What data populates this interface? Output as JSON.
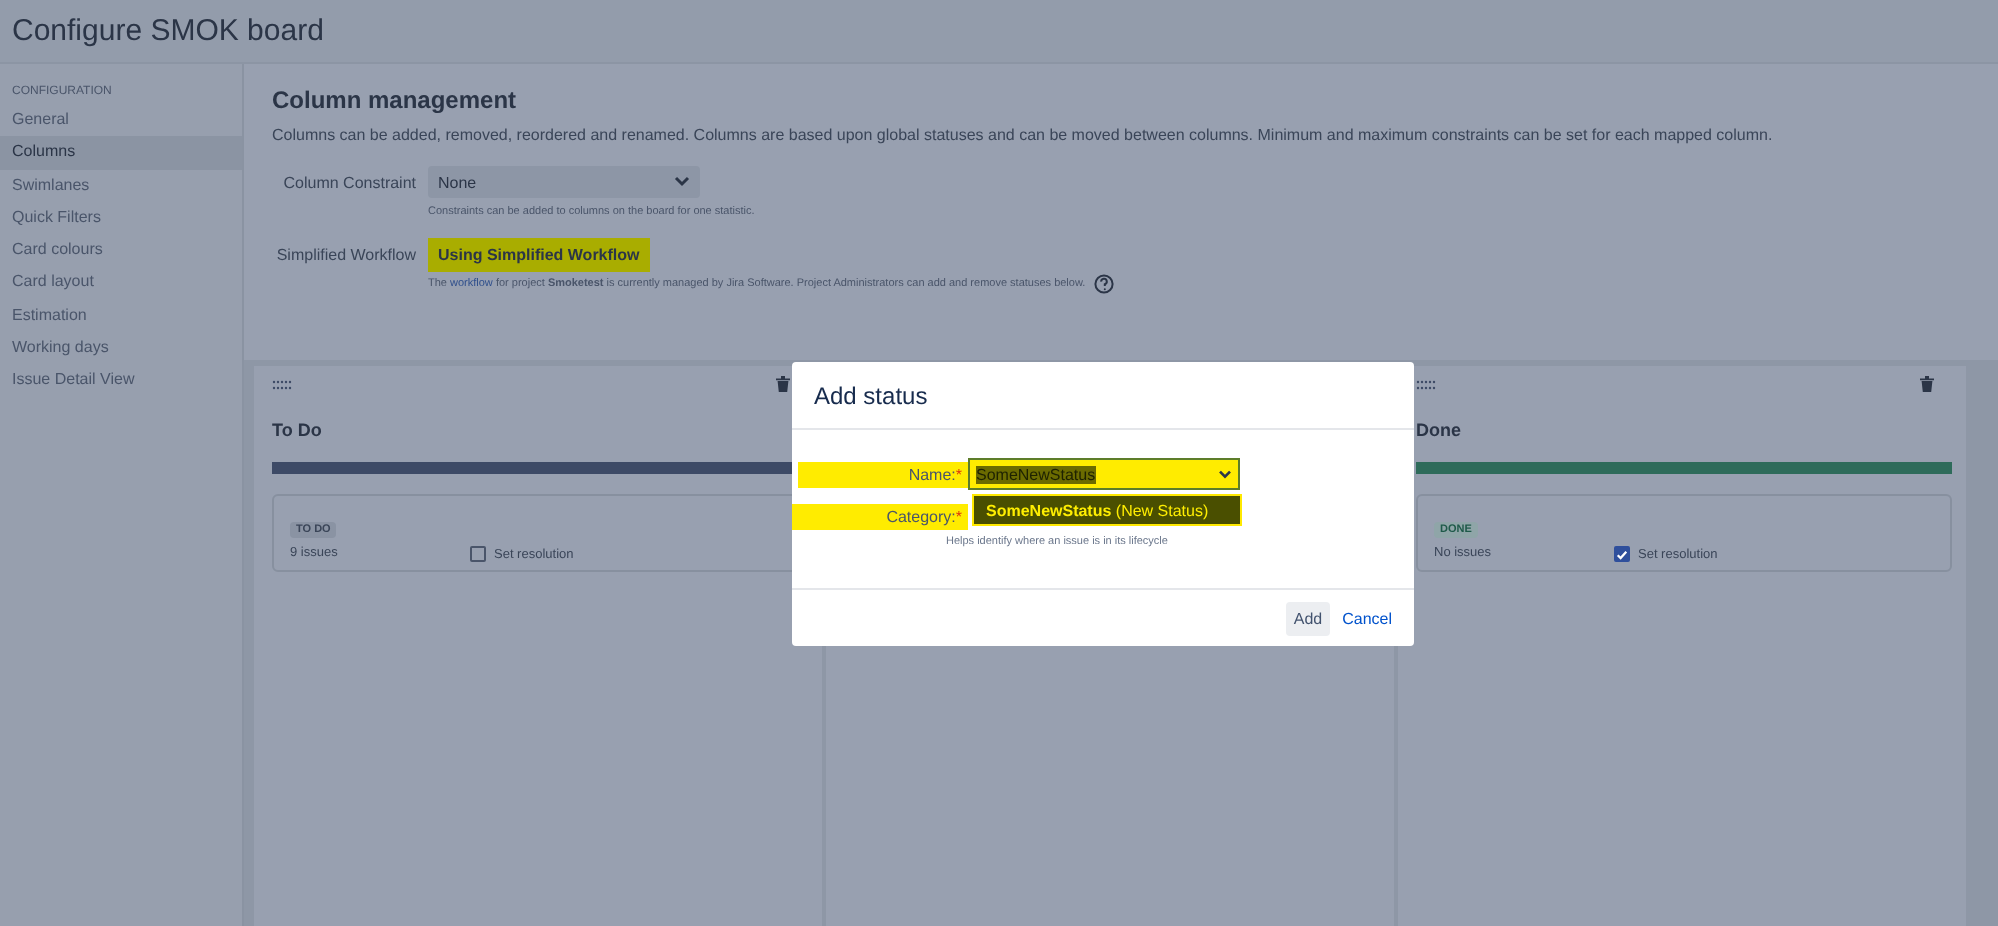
{
  "window": {
    "title": "Configure SMOK board"
  },
  "sidebar": {
    "heading": "CONFIGURATION",
    "items": [
      {
        "label": "General",
        "selected": false
      },
      {
        "label": "Columns",
        "selected": true
      },
      {
        "label": "Swimlanes",
        "selected": false
      },
      {
        "label": "Quick Filters",
        "selected": false
      },
      {
        "label": "Card colours",
        "selected": false
      },
      {
        "label": "Card layout",
        "selected": false
      },
      {
        "label": "Estimation",
        "selected": false
      },
      {
        "label": "Working days",
        "selected": false
      },
      {
        "label": "Issue Detail View",
        "selected": false
      }
    ]
  },
  "section": {
    "title": "Column management",
    "description": "Columns can be added, removed, reordered and renamed. Columns are based upon global statuses and can be moved between columns. Minimum and maximum constraints can be set for each mapped column.",
    "constraint": {
      "label": "Column Constraint",
      "value": "None",
      "hint": "Constraints can be added to columns on the board for one statistic."
    },
    "workflow": {
      "label": "Simplified Workflow",
      "value": "Using Simplified Workflow",
      "highlighted": true,
      "note_start": "The ",
      "note_link": "workflow",
      "note_end": " for project **Smoketest** is currently managed by Jira Software. Project Administrators can add and remove statuses below."
    }
  },
  "columns": [
    {
      "kind": "status",
      "title": "To Do",
      "color": "#3d4a66",
      "status": {
        "label": "TO DO",
        "count": "9 issues",
        "resolution": "Set resolution",
        "checked": false
      }
    },
    {
      "kind": "covered"
    },
    {
      "kind": "status",
      "title": "Done",
      "color": "#2e6b5a",
      "status": {
        "label": "DONE",
        "count": "No issues",
        "resolution": "Set resolution",
        "checked": true
      }
    }
  ],
  "dialog": {
    "title": "Add status",
    "name": {
      "label": "Name:",
      "required_mark": "*",
      "value": "SomeNewStatus",
      "highlighted": true
    },
    "category": {
      "label": "Category:",
      "required_mark": "*",
      "highlighted": true
    },
    "suggestion": "**SomeNewStatus** (New Status)",
    "hint": "Helps identify where an issue is in its lifecycle",
    "buttons": [
      {
        "kind": "button",
        "label": "Add"
      },
      {
        "kind": "link",
        "label": "Cancel"
      }
    ]
  }
}
